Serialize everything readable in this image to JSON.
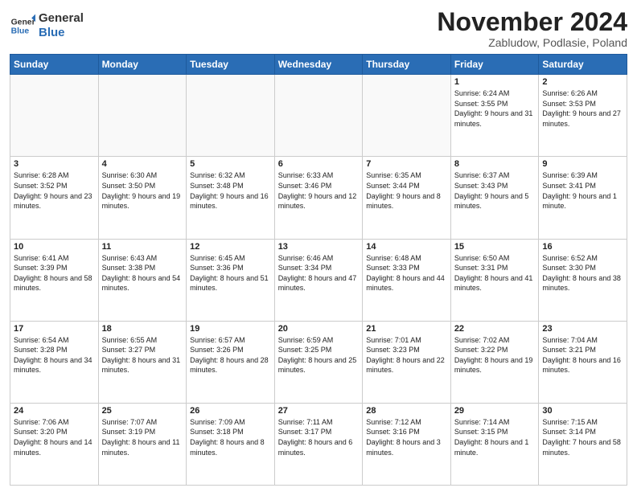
{
  "logo": {
    "line1": "General",
    "line2": "Blue"
  },
  "title": "November 2024",
  "location": "Zabludow, Podlasie, Poland",
  "headers": [
    "Sunday",
    "Monday",
    "Tuesday",
    "Wednesday",
    "Thursday",
    "Friday",
    "Saturday"
  ],
  "weeks": [
    [
      {
        "day": "",
        "info": ""
      },
      {
        "day": "",
        "info": ""
      },
      {
        "day": "",
        "info": ""
      },
      {
        "day": "",
        "info": ""
      },
      {
        "day": "",
        "info": ""
      },
      {
        "day": "1",
        "info": "Sunrise: 6:24 AM\nSunset: 3:55 PM\nDaylight: 9 hours\nand 31 minutes."
      },
      {
        "day": "2",
        "info": "Sunrise: 6:26 AM\nSunset: 3:53 PM\nDaylight: 9 hours\nand 27 minutes."
      }
    ],
    [
      {
        "day": "3",
        "info": "Sunrise: 6:28 AM\nSunset: 3:52 PM\nDaylight: 9 hours\nand 23 minutes."
      },
      {
        "day": "4",
        "info": "Sunrise: 6:30 AM\nSunset: 3:50 PM\nDaylight: 9 hours\nand 19 minutes."
      },
      {
        "day": "5",
        "info": "Sunrise: 6:32 AM\nSunset: 3:48 PM\nDaylight: 9 hours\nand 16 minutes."
      },
      {
        "day": "6",
        "info": "Sunrise: 6:33 AM\nSunset: 3:46 PM\nDaylight: 9 hours\nand 12 minutes."
      },
      {
        "day": "7",
        "info": "Sunrise: 6:35 AM\nSunset: 3:44 PM\nDaylight: 9 hours\nand 8 minutes."
      },
      {
        "day": "8",
        "info": "Sunrise: 6:37 AM\nSunset: 3:43 PM\nDaylight: 9 hours\nand 5 minutes."
      },
      {
        "day": "9",
        "info": "Sunrise: 6:39 AM\nSunset: 3:41 PM\nDaylight: 9 hours\nand 1 minute."
      }
    ],
    [
      {
        "day": "10",
        "info": "Sunrise: 6:41 AM\nSunset: 3:39 PM\nDaylight: 8 hours\nand 58 minutes."
      },
      {
        "day": "11",
        "info": "Sunrise: 6:43 AM\nSunset: 3:38 PM\nDaylight: 8 hours\nand 54 minutes."
      },
      {
        "day": "12",
        "info": "Sunrise: 6:45 AM\nSunset: 3:36 PM\nDaylight: 8 hours\nand 51 minutes."
      },
      {
        "day": "13",
        "info": "Sunrise: 6:46 AM\nSunset: 3:34 PM\nDaylight: 8 hours\nand 47 minutes."
      },
      {
        "day": "14",
        "info": "Sunrise: 6:48 AM\nSunset: 3:33 PM\nDaylight: 8 hours\nand 44 minutes."
      },
      {
        "day": "15",
        "info": "Sunrise: 6:50 AM\nSunset: 3:31 PM\nDaylight: 8 hours\nand 41 minutes."
      },
      {
        "day": "16",
        "info": "Sunrise: 6:52 AM\nSunset: 3:30 PM\nDaylight: 8 hours\nand 38 minutes."
      }
    ],
    [
      {
        "day": "17",
        "info": "Sunrise: 6:54 AM\nSunset: 3:28 PM\nDaylight: 8 hours\nand 34 minutes."
      },
      {
        "day": "18",
        "info": "Sunrise: 6:55 AM\nSunset: 3:27 PM\nDaylight: 8 hours\nand 31 minutes."
      },
      {
        "day": "19",
        "info": "Sunrise: 6:57 AM\nSunset: 3:26 PM\nDaylight: 8 hours\nand 28 minutes."
      },
      {
        "day": "20",
        "info": "Sunrise: 6:59 AM\nSunset: 3:25 PM\nDaylight: 8 hours\nand 25 minutes."
      },
      {
        "day": "21",
        "info": "Sunrise: 7:01 AM\nSunset: 3:23 PM\nDaylight: 8 hours\nand 22 minutes."
      },
      {
        "day": "22",
        "info": "Sunrise: 7:02 AM\nSunset: 3:22 PM\nDaylight: 8 hours\nand 19 minutes."
      },
      {
        "day": "23",
        "info": "Sunrise: 7:04 AM\nSunset: 3:21 PM\nDaylight: 8 hours\nand 16 minutes."
      }
    ],
    [
      {
        "day": "24",
        "info": "Sunrise: 7:06 AM\nSunset: 3:20 PM\nDaylight: 8 hours\nand 14 minutes."
      },
      {
        "day": "25",
        "info": "Sunrise: 7:07 AM\nSunset: 3:19 PM\nDaylight: 8 hours\nand 11 minutes."
      },
      {
        "day": "26",
        "info": "Sunrise: 7:09 AM\nSunset: 3:18 PM\nDaylight: 8 hours\nand 8 minutes."
      },
      {
        "day": "27",
        "info": "Sunrise: 7:11 AM\nSunset: 3:17 PM\nDaylight: 8 hours\nand 6 minutes."
      },
      {
        "day": "28",
        "info": "Sunrise: 7:12 AM\nSunset: 3:16 PM\nDaylight: 8 hours\nand 3 minutes."
      },
      {
        "day": "29",
        "info": "Sunrise: 7:14 AM\nSunset: 3:15 PM\nDaylight: 8 hours\nand 1 minute."
      },
      {
        "day": "30",
        "info": "Sunrise: 7:15 AM\nSunset: 3:14 PM\nDaylight: 7 hours\nand 58 minutes."
      }
    ]
  ]
}
